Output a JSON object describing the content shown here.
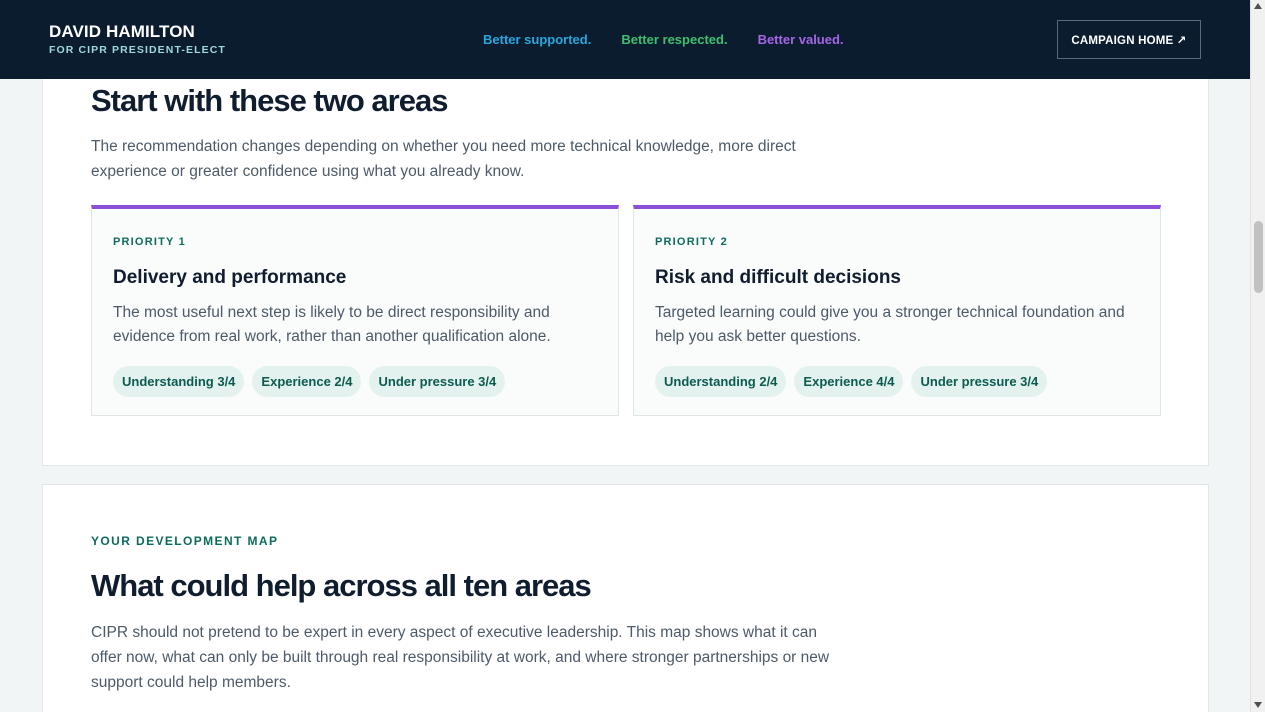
{
  "header": {
    "name": "DAVID HAMILTON",
    "subtitle": "FOR CIPR PRESIDENT-ELECT",
    "taglines": [
      "Better supported.",
      "Better respected.",
      "Better valued."
    ],
    "home_button": "CAMPAIGN HOME ↗"
  },
  "priorities": {
    "title": "Start with these two areas",
    "intro": "The recommendation changes depending on whether you need more technical knowledge, more direct experience or greater confidence using what you already know.",
    "cards": [
      {
        "label": "PRIORITY 1",
        "title": "Delivery and performance",
        "text": "The most useful next step is likely to be direct responsibility and evidence from real work, rather than another qualification alone.",
        "chips": [
          "Understanding 3/4",
          "Experience 2/4",
          "Under pressure 3/4"
        ]
      },
      {
        "label": "PRIORITY 2",
        "title": "Risk and difficult decisions",
        "text": "Targeted learning could give you a stronger technical foundation and help you ask better questions.",
        "chips": [
          "Understanding 2/4",
          "Experience 4/4",
          "Under pressure 3/4"
        ]
      }
    ]
  },
  "map": {
    "kicker": "YOUR DEVELOPMENT MAP",
    "title": "What could help across all ten areas",
    "intro": "CIPR should not pretend to be expert in every aspect of executive leadership. This map shows what it can offer now, what can only be built through real responsibility at work, and where stronger partnerships or new support could help members."
  },
  "colors": {
    "header_bg": "#0b1c2e",
    "accent_purple": "#8b4fd9",
    "teal": "#0d6b5e",
    "tag_blue": "#2aa6dd",
    "tag_green": "#3fbf6e",
    "tag_purple": "#a566e6"
  }
}
